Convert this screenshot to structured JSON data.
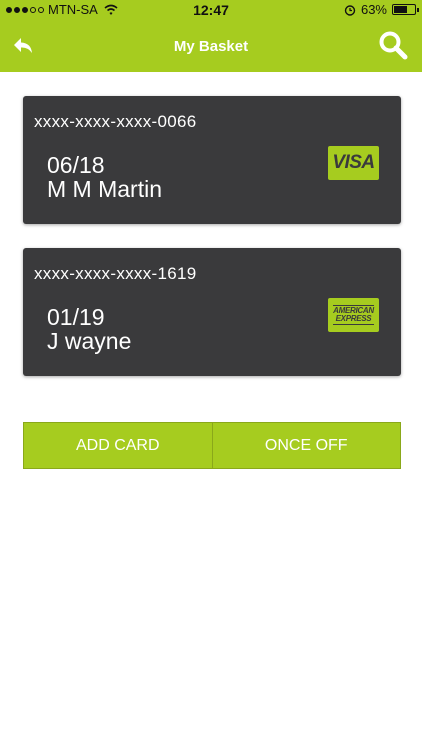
{
  "status_bar": {
    "carrier": "MTN-SA",
    "time": "12:47",
    "battery": "63%",
    "battery_level": 0.63
  },
  "nav": {
    "title": "My Basket",
    "back_icon": "back-arrow-icon",
    "search_icon": "search-icon"
  },
  "cards": [
    {
      "number": "xxxx-xxxx-xxxx-0066",
      "expiry": "06/18",
      "name": "M M Martin",
      "brand": "VISA"
    },
    {
      "number": "xxxx-xxxx-xxxx-1619",
      "expiry": "01/19",
      "name": "J wayne",
      "brand_line1": "AMERICAN",
      "brand_line2": "EXPRESS"
    }
  ],
  "buttons": {
    "add_card": "ADD CARD",
    "once_off": "ONCE OFF"
  },
  "colors": {
    "accent": "#a6cc1f",
    "card_bg": "#3a3a3c"
  }
}
